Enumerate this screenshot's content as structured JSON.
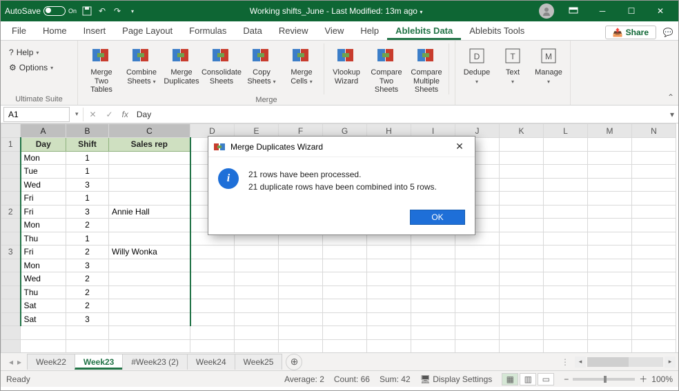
{
  "titlebar": {
    "autosave": "AutoSave",
    "toggle_state": "On",
    "filename": "Working shifts_June",
    "modified": "Last Modified: 13m ago"
  },
  "tabs": {
    "items": [
      "File",
      "Home",
      "Insert",
      "Page Layout",
      "Formulas",
      "Data",
      "Review",
      "View",
      "Help",
      "Ablebits Data",
      "Ablebits Tools"
    ],
    "active": 9,
    "share": "Share"
  },
  "ribbon": {
    "left": {
      "help": "Help",
      "options": "Options",
      "label": "Ultimate Suite"
    },
    "merge": {
      "label": "Merge",
      "items": [
        {
          "l1": "Merge",
          "l2": "Two Tables"
        },
        {
          "l1": "Combine",
          "l2": "Sheets",
          "caret": true
        },
        {
          "l1": "Merge",
          "l2": "Duplicates"
        },
        {
          "l1": "Consolidate",
          "l2": "Sheets"
        },
        {
          "l1": "Copy",
          "l2": "Sheets",
          "caret": true
        },
        {
          "l1": "Merge",
          "l2": "Cells",
          "caret": true
        },
        {
          "l1": "Vlookup",
          "l2": "Wizard"
        },
        {
          "l1": "Compare",
          "l2": "Two Sheets"
        },
        {
          "l1": "Compare",
          "l2": "Multiple Sheets"
        }
      ]
    },
    "after": [
      {
        "l1": "Dedupe",
        "caret": true
      },
      {
        "l1": "Text",
        "caret": true
      },
      {
        "l1": "Manage",
        "caret": true
      }
    ]
  },
  "fbar": {
    "name": "A1",
    "fx": "fx",
    "value": "Day"
  },
  "columns": [
    "A",
    "B",
    "C",
    "D",
    "E",
    "F",
    "G",
    "H",
    "I",
    "J",
    "K",
    "L",
    "M",
    "N"
  ],
  "headers": {
    "a": "Day",
    "b": "Shift",
    "c": "Sales rep"
  },
  "rows": [
    {
      "rh": "",
      "a": "Mon",
      "b": "1",
      "c": ""
    },
    {
      "rh": "",
      "a": "Tue",
      "b": "1",
      "c": ""
    },
    {
      "rh": "",
      "a": "Wed",
      "b": "3",
      "c": ""
    },
    {
      "rh": "",
      "a": "Fri",
      "b": "1",
      "c": ""
    },
    {
      "rh": "2",
      "a": "Fri",
      "b": "3",
      "c": "Annie Hall"
    },
    {
      "rh": "",
      "a": "Mon",
      "b": "2",
      "c": ""
    },
    {
      "rh": "",
      "a": "Thu",
      "b": "1",
      "c": ""
    },
    {
      "rh": "3",
      "a": "Fri",
      "b": "2",
      "c": "Willy Wonka"
    },
    {
      "rh": "",
      "a": "Mon",
      "b": "3",
      "c": ""
    },
    {
      "rh": "",
      "a": "Wed",
      "b": "2",
      "c": ""
    },
    {
      "rh": "",
      "a": "Thu",
      "b": "2",
      "c": ""
    },
    {
      "rh": "",
      "a": "Sat",
      "b": "2",
      "c": ""
    },
    {
      "rh": "",
      "a": "Sat",
      "b": "3",
      "c": ""
    }
  ],
  "row1h": "1",
  "sheets": {
    "items": [
      "Week22",
      "Week23",
      "#Week23 (2)",
      "Week24",
      "Week25"
    ],
    "active": 1
  },
  "status": {
    "ready": "Ready",
    "avg": "Average: 2",
    "count": "Count: 66",
    "sum": "Sum: 42",
    "disp": "Display Settings",
    "zoom": "100%"
  },
  "dialog": {
    "title": "Merge Duplicates Wizard",
    "line1": "21 rows have been processed.",
    "line2": "21 duplicate rows have been combined into 5 rows.",
    "ok": "OK"
  }
}
